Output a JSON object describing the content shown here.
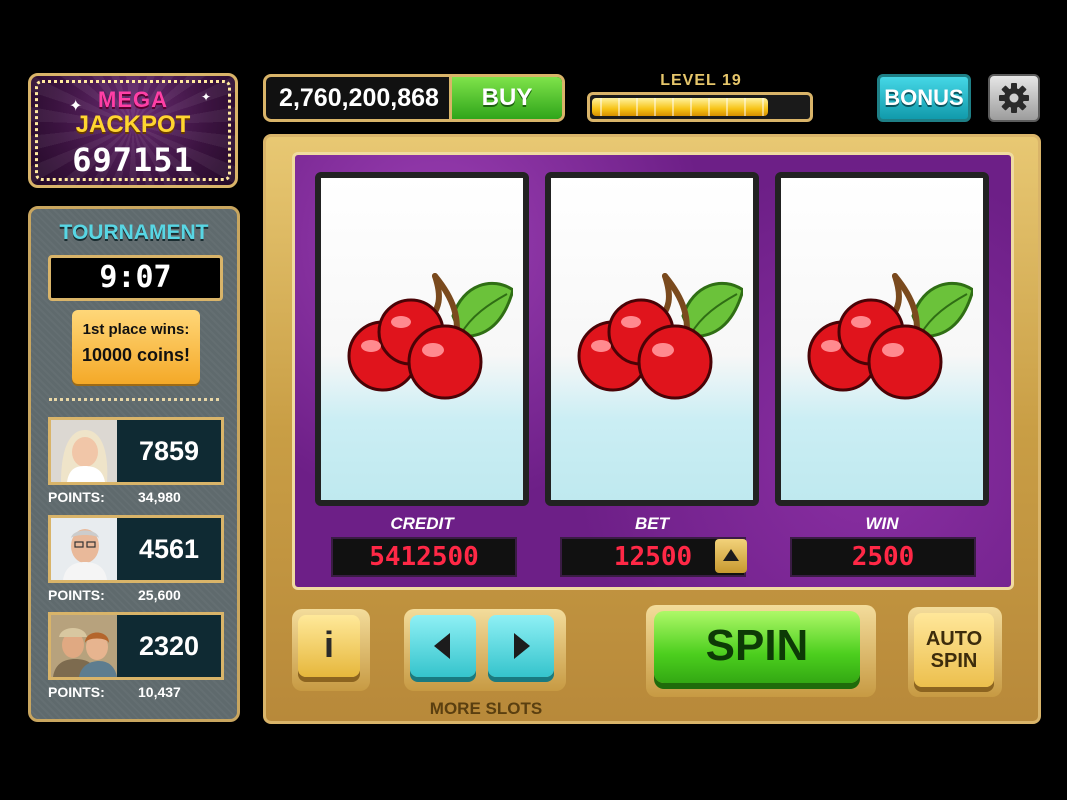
{
  "jackpot": {
    "line1": "MEGA",
    "line2": "JACKPOT",
    "value": "697151"
  },
  "coins": {
    "balance": "2,760,200,868",
    "buy_label": "BUY"
  },
  "level": {
    "label": "LEVEL 19",
    "progress": 0.8
  },
  "bonus_label": "BONUS",
  "settings_icon": "gear-icon",
  "tournament": {
    "title": "TOURNAMENT",
    "timer": "9:07",
    "prize_line1": "1st place wins:",
    "prize_line2": "10000 coins!",
    "players": [
      {
        "score": "7859",
        "points_label": "POINTS:",
        "points": "34,980"
      },
      {
        "score": "4561",
        "points_label": "POINTS:",
        "points": "25,600"
      },
      {
        "score": "2320",
        "points_label": "POINTS:",
        "points": "10,437"
      }
    ]
  },
  "reels": [
    "cherries",
    "cherries",
    "cherries"
  ],
  "meters": {
    "credit_label": "CREDIT",
    "credit": "5412500",
    "bet_label": "BET",
    "bet": "12500",
    "win_label": "WIN",
    "win": "2500"
  },
  "buttons": {
    "info": "i",
    "more_slots": "MORE SLOTS",
    "spin": "SPIN",
    "auto_line1": "AUTO",
    "auto_line2": "SPIN"
  },
  "colors": {
    "gold_frame": "#d9b469",
    "reel_panel": "#6d1f87",
    "meter_text": "#ff2846",
    "spin_green": "#4ccf1e"
  }
}
